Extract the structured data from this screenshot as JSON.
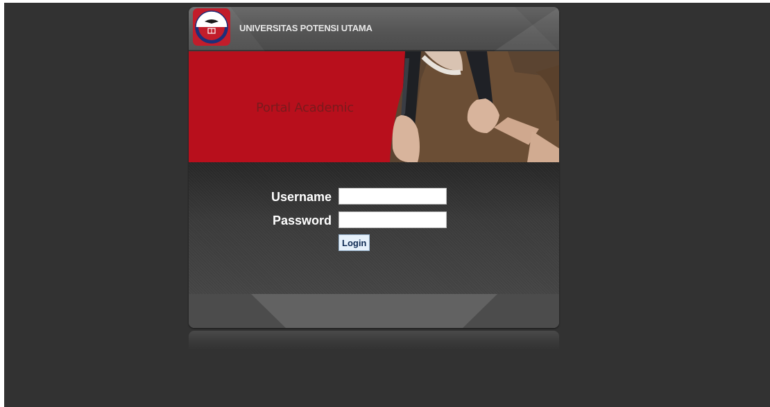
{
  "header": {
    "site_title": "UNIVERSITAS POTENSI UTAMA",
    "logo_icon": "university-seal-icon"
  },
  "banner": {
    "text": "Portal Academic",
    "background_color": "#b80f1c",
    "image": "student-with-backpack"
  },
  "login_form": {
    "username_label": "Username",
    "username_value": "",
    "password_label": "Password",
    "password_value": "",
    "login_button_label": "Login"
  },
  "colors": {
    "page_background": "#323232",
    "header_background": "#595959",
    "banner_red": "#b80f1c",
    "login_panel": "#333333",
    "button_background": "#e6f1fb"
  }
}
